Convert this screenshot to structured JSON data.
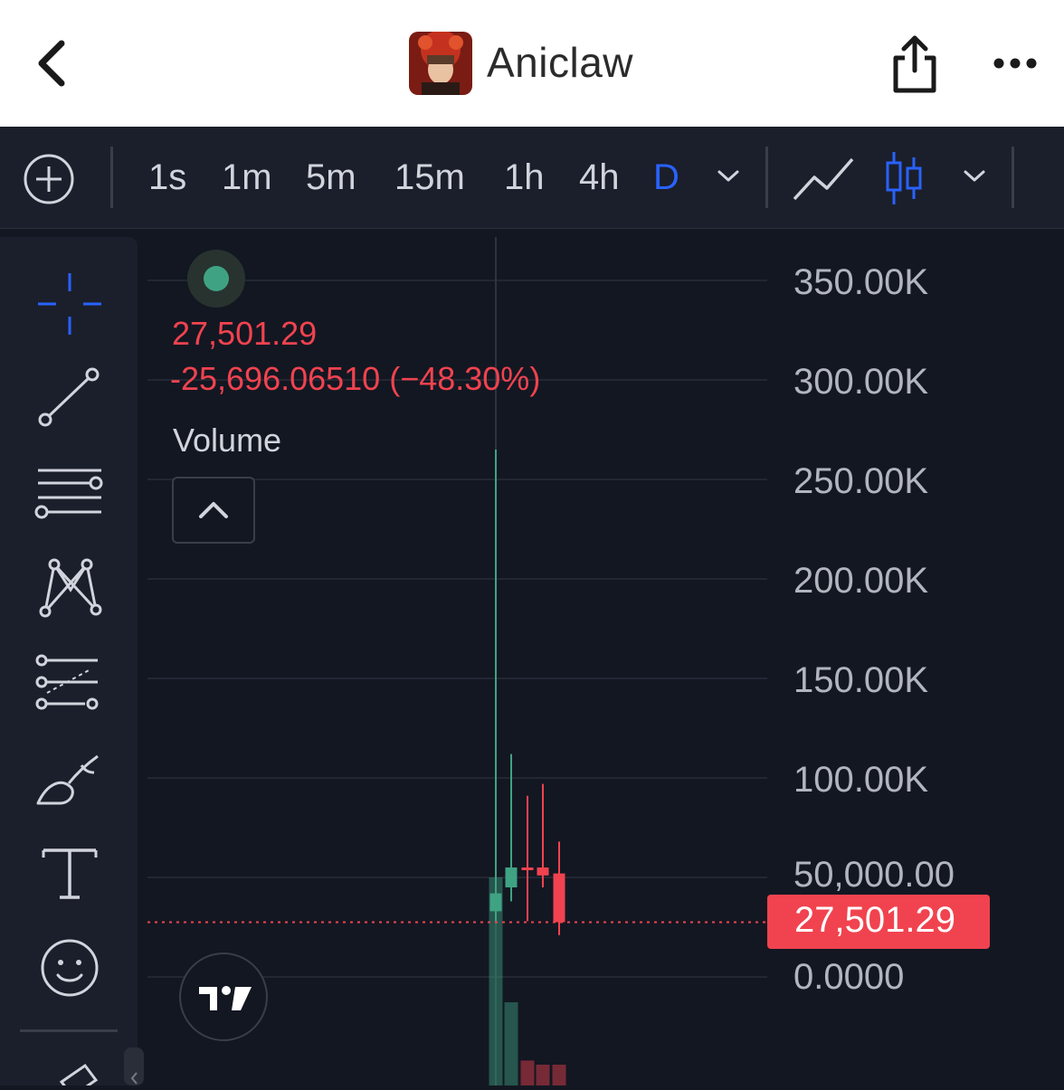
{
  "header": {
    "token_name": "Aniclaw",
    "icons": [
      "back-chevron-icon",
      "share-icon",
      "more-dots-icon"
    ]
  },
  "toolbar": {
    "timeframes": [
      "1s",
      "1m",
      "5m",
      "15m",
      "1h",
      "4h",
      "D"
    ],
    "active_timeframe": "D",
    "accent_color": "#2962ff"
  },
  "legend": {
    "price": "27,501.29",
    "change": "-25,696.06510 (−48.30%)",
    "volume_label": "Volume"
  },
  "axis": {
    "labels": [
      "350.00K",
      "300.00K",
      "250.00K",
      "200.00K",
      "150.00K",
      "100.00K",
      "50,000.00",
      "0.0000"
    ],
    "last_price": "27,501.29"
  },
  "colors": {
    "up": "#3fa383",
    "down": "#f0434f",
    "background": "#131722"
  },
  "chart_data": {
    "type": "candlestick",
    "ylim": [
      0,
      350000
    ],
    "candles": [
      {
        "open": 33000,
        "close": 42000,
        "high": 265000,
        "low": 28000
      },
      {
        "open": 45000,
        "close": 55000,
        "high": 112000,
        "low": 38000
      },
      {
        "open": 55000,
        "close": 54000,
        "high": 91000,
        "low": 28000
      },
      {
        "open": 55000,
        "close": 51000,
        "high": 97000,
        "low": 45000
      },
      {
        "open": 52000,
        "close": 27501,
        "high": 68000,
        "low": 21000
      }
    ],
    "volume": [
      {
        "value": 1.0,
        "direction": "up"
      },
      {
        "value": 0.4,
        "direction": "up"
      },
      {
        "value": 0.12,
        "direction": "down"
      },
      {
        "value": 0.1,
        "direction": "down"
      },
      {
        "value": 0.1,
        "direction": "down"
      }
    ],
    "last_price": 27501.29
  }
}
